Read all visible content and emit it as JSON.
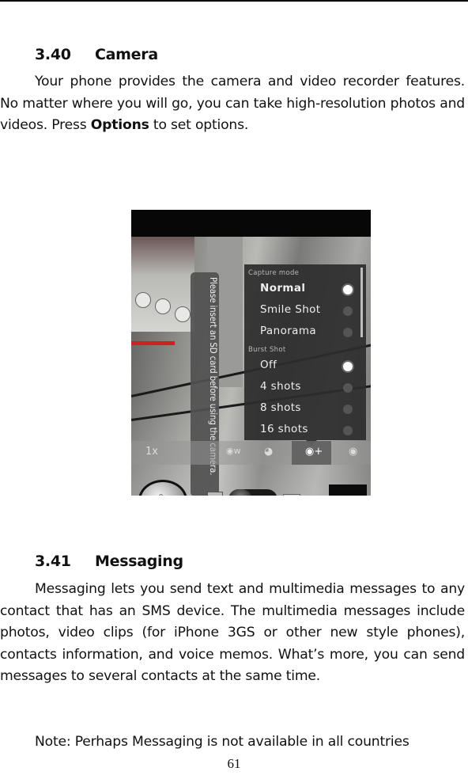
{
  "section_camera": {
    "number": "3.40",
    "title": "Camera",
    "paragraph_before": "Your phone provides the camera and video recorder features. No matter where you will go, you can take high-resolution photos and videos. Press ",
    "paragraph_bold": "Options",
    "paragraph_after": " to set options."
  },
  "camera_screenshot": {
    "toast": "Please insert an SD card before using the camera.",
    "capture_mode": {
      "label": "Capture mode",
      "options": [
        {
          "label": "Normal",
          "selected": true
        },
        {
          "label": "Smile Shot",
          "selected": false
        },
        {
          "label": "Panorama",
          "selected": false
        }
      ]
    },
    "burst_shot": {
      "label": "Burst Shot",
      "options": [
        {
          "label": "Off",
          "selected": true
        },
        {
          "label": "4 shots",
          "selected": false
        },
        {
          "label": "8 shots",
          "selected": false
        },
        {
          "label": "16 shots",
          "selected": false
        }
      ]
    },
    "toolbar": {
      "zoom_label": "1x",
      "icons": [
        "zoom-icon",
        "white-balance-icon",
        "scene-mode-icon",
        "capture-settings-icon",
        "settings-icon"
      ]
    },
    "mode_switch": {
      "selected": "camera"
    }
  },
  "section_messaging": {
    "number": "3.41",
    "title": "Messaging",
    "paragraph1": "Messaging lets you send text and multimedia messages to any contact that has an SMS device. The multimedia messages include photos, video clips (for iPhone 3GS or other new style phones), contacts information, and voice memos. What’s more, you can send messages to several contacts at the same time.",
    "paragraph2": "Note: Perhaps Messaging is not available in all countries"
  },
  "page_number": "61"
}
